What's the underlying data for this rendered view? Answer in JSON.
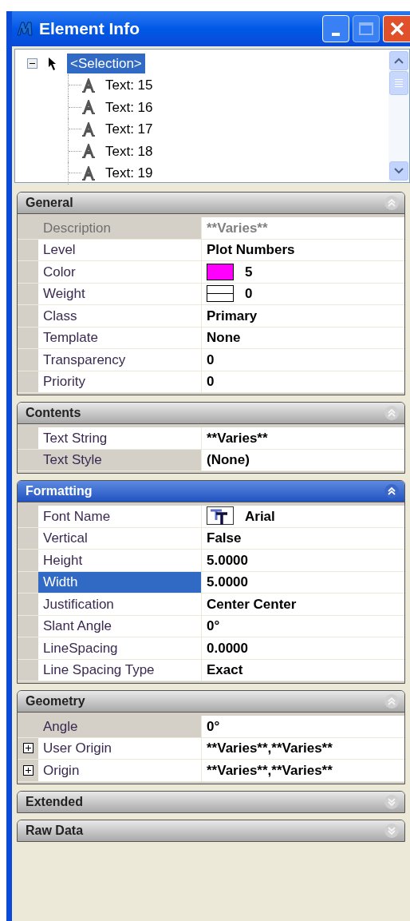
{
  "window": {
    "title": "Element Info"
  },
  "tree": {
    "label": "<Selection>",
    "selected": true,
    "expanded": true,
    "children": [
      {
        "label": "Text: 15",
        "selected": false
      },
      {
        "label": "Text: 16",
        "selected": false
      },
      {
        "label": "Text: 17",
        "selected": false
      },
      {
        "label": "Text: 18",
        "selected": false
      },
      {
        "label": "Text: 19",
        "selected": false
      }
    ]
  },
  "sections": [
    {
      "title": "General",
      "active": false,
      "expanded": true,
      "rows": [
        {
          "label": "Description",
          "value": "**Varies**",
          "kind": "text",
          "disabled": true,
          "selected": false
        },
        {
          "label": "Level",
          "value": "Plot Numbers",
          "kind": "text",
          "disabled": false,
          "selected": false
        },
        {
          "label": "Color",
          "value": "5",
          "kind": "color",
          "color": "#ff00ff",
          "disabled": false,
          "selected": false
        },
        {
          "label": "Weight",
          "value": "0",
          "kind": "weight",
          "disabled": false,
          "selected": false
        },
        {
          "label": "Class",
          "value": "Primary",
          "kind": "text",
          "disabled": false,
          "selected": false
        },
        {
          "label": "Template",
          "value": "None",
          "kind": "text",
          "disabled": false,
          "selected": false
        },
        {
          "label": "Transparency",
          "value": "0",
          "kind": "text",
          "disabled": false,
          "selected": false
        },
        {
          "label": "Priority",
          "value": "0",
          "kind": "text",
          "disabled": false,
          "selected": false
        }
      ]
    },
    {
      "title": "Contents",
      "active": false,
      "expanded": true,
      "rows": [
        {
          "label": "Text String",
          "value": "**Varies**",
          "kind": "text",
          "disabled": false,
          "selected": false
        },
        {
          "label": "Text Style",
          "value": "(None)",
          "kind": "text",
          "disabled": false,
          "selected": true
        }
      ]
    },
    {
      "title": "Formatting",
      "active": true,
      "expanded": true,
      "rows": [
        {
          "label": "Font Name",
          "value": "Arial",
          "kind": "font",
          "disabled": false,
          "selected": false
        },
        {
          "label": "Vertical",
          "value": "False",
          "kind": "text",
          "disabled": false,
          "selected": false
        },
        {
          "label": "Height",
          "value": "5.0000",
          "kind": "text",
          "disabled": false,
          "selected": false
        },
        {
          "label": "Width",
          "value": "5.0000",
          "kind": "text",
          "disabled": false,
          "selected": true
        },
        {
          "label": "Justification",
          "value": "Center Center",
          "kind": "text",
          "disabled": false,
          "selected": false
        },
        {
          "label": "Slant Angle",
          "value": "0°",
          "kind": "text",
          "disabled": false,
          "selected": false
        },
        {
          "label": "LineSpacing",
          "value": "0.0000",
          "kind": "text",
          "disabled": false,
          "selected": false
        },
        {
          "label": "Line Spacing Type",
          "value": "Exact",
          "kind": "text",
          "disabled": false,
          "selected": false
        }
      ]
    },
    {
      "title": "Geometry",
      "active": false,
      "expanded": true,
      "rows": [
        {
          "label": "Angle",
          "value": "0°",
          "kind": "text",
          "disabled": false,
          "selected": true
        },
        {
          "label": "User Origin",
          "value": "**Varies**,**Varies**",
          "kind": "text",
          "expandable": true,
          "disabled": false,
          "selected": false
        },
        {
          "label": "Origin",
          "value": "**Varies**,**Varies**",
          "kind": "text",
          "expandable": true,
          "disabled": false,
          "selected": false
        }
      ]
    },
    {
      "title": "Extended",
      "active": false,
      "expanded": false
    },
    {
      "title": "Raw Data",
      "active": false,
      "expanded": false
    }
  ]
}
